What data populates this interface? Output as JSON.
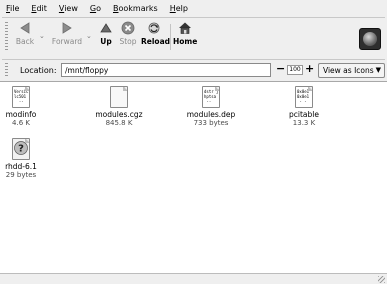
{
  "menubar": {
    "items": [
      {
        "first": "F",
        "rest": "ile"
      },
      {
        "first": "E",
        "rest": "dit"
      },
      {
        "first": "V",
        "rest": "iew"
      },
      {
        "first": "G",
        "rest": "o"
      },
      {
        "first": "B",
        "rest": "ookmarks"
      },
      {
        "first": "H",
        "rest": "elp"
      }
    ]
  },
  "toolbar": {
    "back_label": "Back",
    "forward_label": "Forward",
    "up_label": "Up",
    "stop_label": "Stop",
    "reload_label": "Reload",
    "home_label": "Home"
  },
  "location": {
    "label": "Location:",
    "value": "/mnt/floppy",
    "zoom_minus": "−",
    "zoom_value": "100",
    "zoom_plus": "+",
    "view_mode": "View as Icons"
  },
  "files": [
    {
      "name": "modinfo",
      "size": "4.6 K",
      "preview": "Versic\nlc501\n  --",
      "kind": "text"
    },
    {
      "name": "modules.cgz",
      "size": "845.8 K",
      "preview": "",
      "kind": "blank"
    },
    {
      "name": "modules.dep",
      "size": "733 bytes",
      "preview": "dstr j\nhptsa\n --",
      "kind": "text"
    },
    {
      "name": "pcitable",
      "size": "13.3 K",
      "preview": "0x0e1\n0x0e1\n - -",
      "kind": "text"
    },
    {
      "name": "rhdd-6.1",
      "size": "29 bytes",
      "preview": "",
      "kind": "unknown"
    }
  ]
}
